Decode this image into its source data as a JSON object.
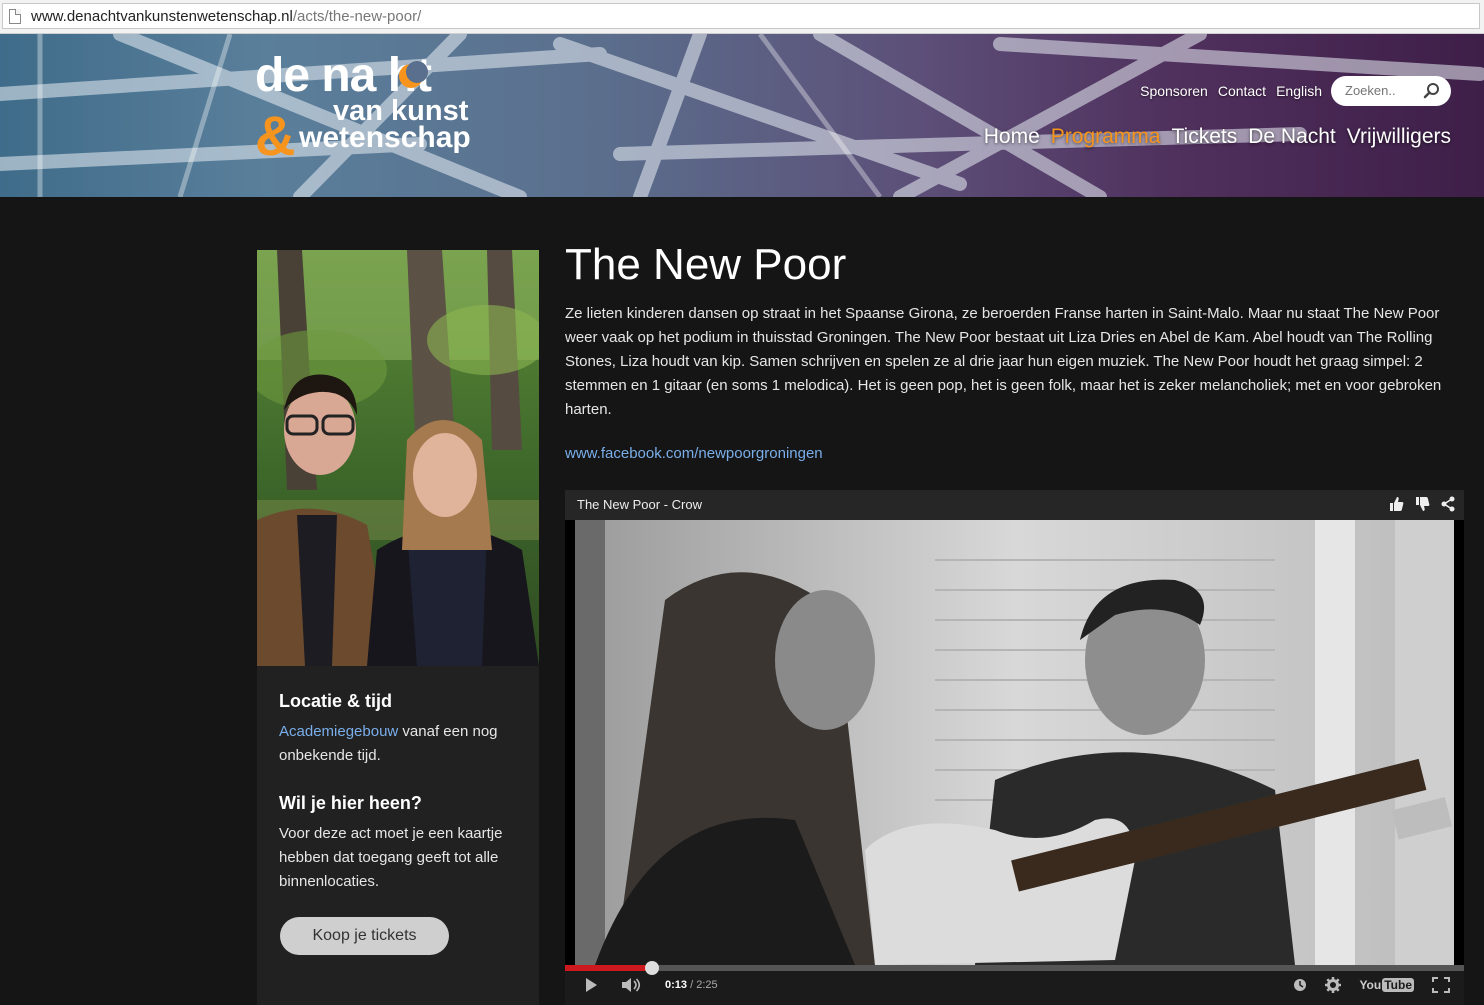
{
  "browser": {
    "url_host": "www.denachtvankunstenwetenschap.nl",
    "url_path": "/acts/the-new-poor/"
  },
  "logo": {
    "line1": "de na ht",
    "line2": "van kunst",
    "amp": "&",
    "line3": "wetenschap"
  },
  "topnav": {
    "items": [
      "Sponsoren",
      "Contact",
      "English"
    ]
  },
  "search": {
    "placeholder": "Zoeken.."
  },
  "mainnav": {
    "items": [
      "Home",
      "Programma",
      "Tickets",
      "De Nacht",
      "Vrijwilligers"
    ],
    "active": "Programma",
    "accent_color": "#f7941d"
  },
  "sidebar": {
    "location_heading": "Locatie & tijd",
    "location_link": "Academiegebouw",
    "location_text": " vanaf een nog onbekende tijd.",
    "go_heading": "Wil je hier heen?",
    "go_text": "Voor deze act moet je een kaartje hebben dat toegang geeft tot alle binnenlocaties.",
    "ticket_button": "Koop je tickets"
  },
  "act": {
    "title": "The New Poor",
    "description": "Ze lieten kinderen dansen op straat in het Spaanse Girona, ze beroerden Franse harten in Saint-Malo. Maar nu staat The New Poor weer vaak op het podium in thuisstad Groningen. The New Poor bestaat uit Liza Dries en Abel de Kam. Abel houdt van The Rolling Stones, Liza houdt van kip. Samen schrijven en spelen ze al drie jaar hun eigen muziek. The New Poor houdt het graag simpel: 2 stemmen en 1 gitaar (en soms 1 melodica). Het is geen pop, het is geen folk, maar het is zeker melancholiek; met en voor gebroken harten.",
    "facebook_link": "www.facebook.com/newpoorgroningen"
  },
  "video": {
    "title": "The New Poor - Crow",
    "current_time": "0:13",
    "duration": " / 2:25",
    "progress": 0.097,
    "youtube_label": "You",
    "youtube_tube": "Tube"
  }
}
